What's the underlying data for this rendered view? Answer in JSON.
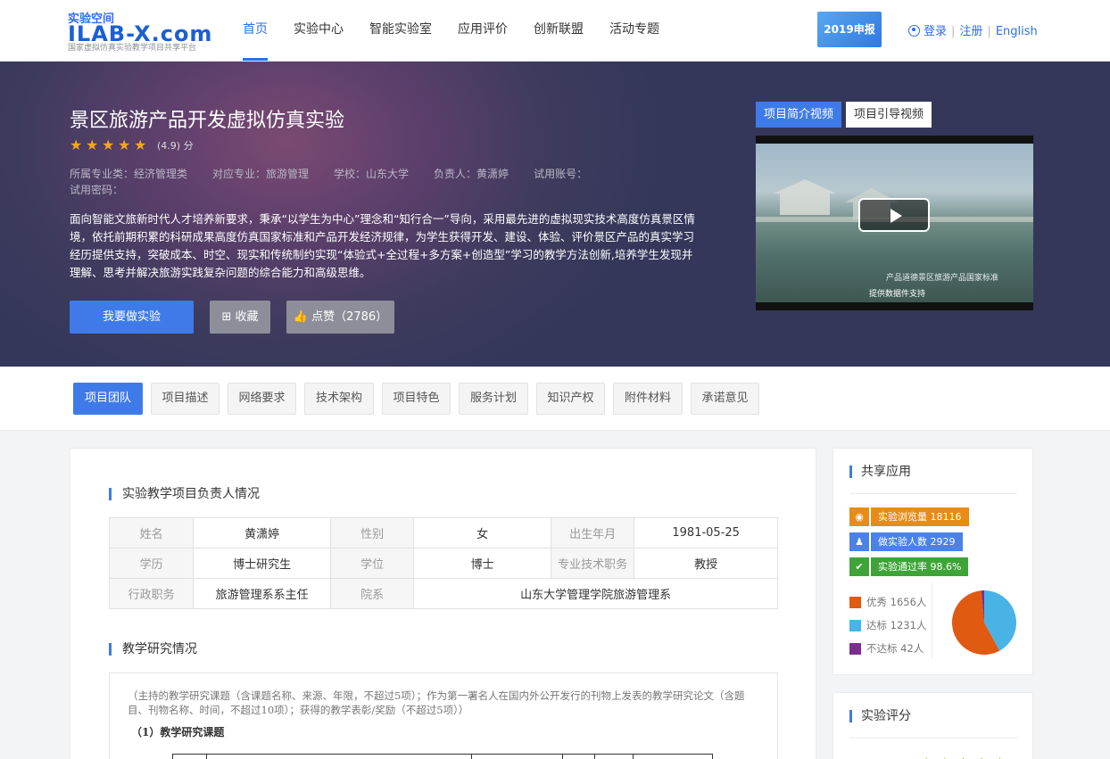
{
  "header": {
    "logo_top": "实验空间",
    "logo_main": "ILAB-X.com",
    "logo_sub": "国家虚拟仿真实验教学项目共享平台",
    "nav": [
      "首页",
      "实验中心",
      "智能实验室",
      "应用评价",
      "创新联盟",
      "活动专题"
    ],
    "apply_badge": "2019申报",
    "login": "登录",
    "register": "注册",
    "english": "English"
  },
  "hero": {
    "title": "景区旅游产品开发虚拟仿真实验",
    "stars": 5,
    "score": "(4.9) 分",
    "meta_major_category": "所属专业类：经济管理类",
    "meta_major": "对应专业：旅游管理",
    "meta_school": "学校：山东大学",
    "meta_owner": "负责人：黄潇婷",
    "meta_trial_account": "试用账号：",
    "meta_trial_password": "试用密码：",
    "description": "面向智能文旅新时代人才培养新要求，秉承“以学生为中心”理念和“知行合一”导向，采用最先进的虚拟现实技术高度仿真景区情境，依托前期积累的科研成果高度仿真国家标准和产品开发经济规律，为学生获得开发、建设、体验、评价景区产品的真实学习经历提供支持，突破成本、时空、现实和传统制约实现“体验式+全过程+多方案+创造型”学习的教学方法创新,培养学生发现并理解、思考并解决旅游实践复杂问题的综合能力和高级思维。",
    "btn_experiment": "我要做实验",
    "btn_favorite": "收藏",
    "btn_like": "点赞（2786）",
    "video_tab_intro": "项目简介视频",
    "video_tab_guide": "项目引导视频",
    "video_caption1": "产品道德景区旅游产品国家标准",
    "video_caption2": "提供数据件支持"
  },
  "tabs": [
    "项目团队",
    "项目描述",
    "网络要求",
    "技术架构",
    "项目特色",
    "服务计划",
    "知识产权",
    "附件材料",
    "承诺意见"
  ],
  "team": {
    "section_title": "实验教学项目负责人情况",
    "rows": [
      [
        [
          "姓名",
          "k"
        ],
        [
          "黄潇婷",
          "v"
        ],
        [
          "性别",
          "k"
        ],
        [
          "女",
          "v"
        ],
        [
          "出生年月",
          "k"
        ],
        [
          "1981-05-25",
          "v"
        ]
      ],
      [
        [
          "学历",
          "k"
        ],
        [
          "博士研究生",
          "v"
        ],
        [
          "学位",
          "k"
        ],
        [
          "博士",
          "v"
        ],
        [
          "专业技术职务",
          "k"
        ],
        [
          "教授",
          "v"
        ]
      ]
    ],
    "row3_k1": "行政职务",
    "row3_v1": "旅游管理系系主任",
    "row3_k2": "院系",
    "row3_v2": "山东大学管理学院旅游管理系"
  },
  "research": {
    "section_title": "教学研究情况",
    "note": "（主持的教学研究课题（含课题名称、来源、年限，不超过5项）；作为第一署名人在国内外公开发行的刊物上发表的教学研究论文（含题目、刊物名称、时间，不超过10项）；获得的教学表彰/奖励（不超过5项））",
    "sub_title": "（1）教学研究课题"
  },
  "share": {
    "title": "共享应用",
    "views": "实验浏览量 18116",
    "participants": "做实验人数 2929",
    "pass_rate": "实验通过率 98.6%",
    "legend": [
      {
        "label": "优秀 1656人",
        "color": "#e05a12",
        "value": 1656
      },
      {
        "label": "达标 1231人",
        "color": "#4ab3e6",
        "value": 1231
      },
      {
        "label": "不达标 42人",
        "color": "#7a2f8f",
        "value": 42
      }
    ]
  },
  "rating": {
    "title": "实验评分"
  }
}
